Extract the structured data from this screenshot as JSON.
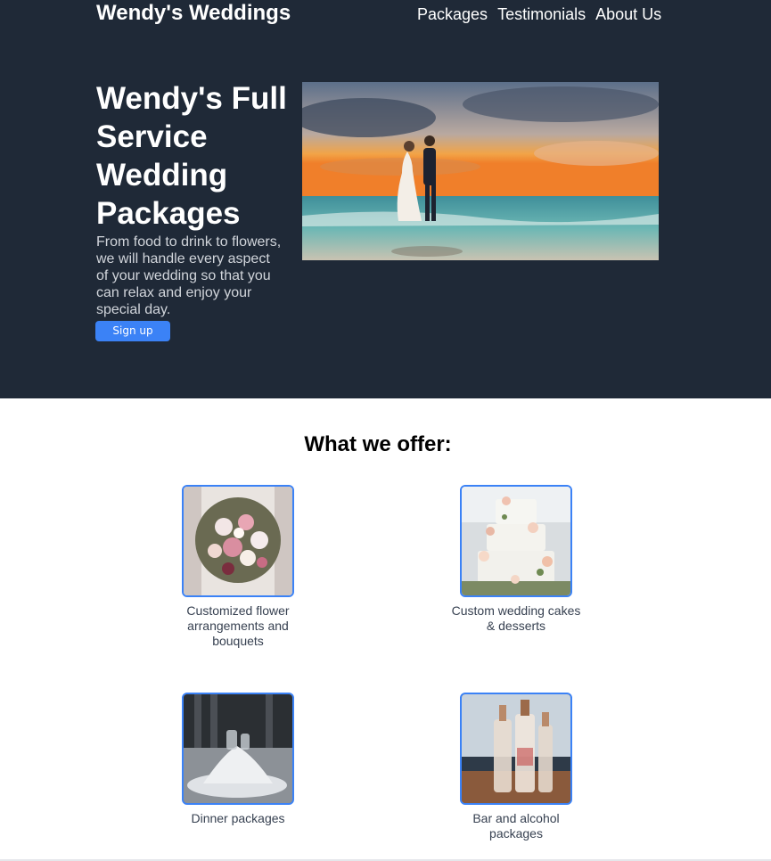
{
  "header": {
    "brand": "Wendy's Weddings",
    "nav": [
      "Packages",
      "Testimonials",
      "About Us"
    ]
  },
  "hero": {
    "title": "Wendy's Full Service Wedding Packages",
    "description": "From food to drink to flowers, we will handle every aspect of your wedding so that you can relax and enjoy your special day.",
    "signup_label": "Sign up",
    "image": "beach-wedding-couple-photo"
  },
  "offer": {
    "title": "What we offer:",
    "items": [
      {
        "caption": "Customized flower arrangements and bouquets",
        "image": "bouquet-photo"
      },
      {
        "caption": "Custom wedding cakes & desserts",
        "image": "wedding-cake-photo"
      },
      {
        "caption": "Dinner packages",
        "image": "dinner-table-photo"
      },
      {
        "caption": "Bar and alcohol packages",
        "image": "liquor-bottles-photo"
      }
    ]
  },
  "colors": {
    "dark_bg": "#1f2937",
    "accent": "#3b82f6"
  }
}
